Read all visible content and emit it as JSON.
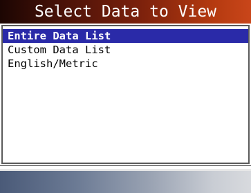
{
  "title": "Select Data to View",
  "menu": {
    "items": [
      {
        "label": "Entire Data List",
        "selected": true
      },
      {
        "label": "Custom Data List",
        "selected": false
      },
      {
        "label": "English/Metric",
        "selected": false
      }
    ]
  },
  "colors": {
    "title_gradient_start": "#1c0603",
    "title_gradient_end": "#c9461a",
    "selection": "#2a2aa8",
    "status_gradient_start": "#4a5a78",
    "status_gradient_end": "#d8dade"
  }
}
